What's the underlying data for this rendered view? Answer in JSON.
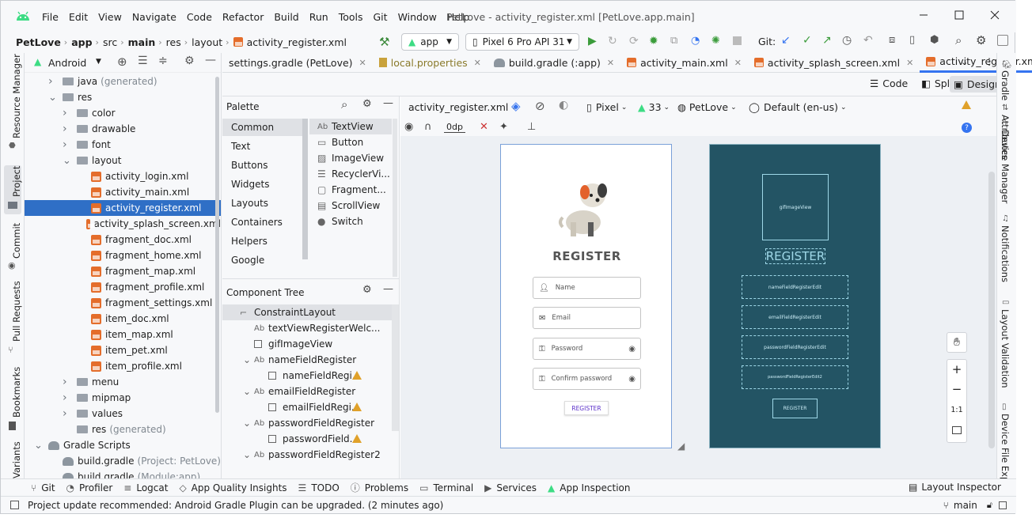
{
  "titlebar": {
    "menu": [
      "File",
      "Edit",
      "View",
      "Navigate",
      "Code",
      "Refactor",
      "Build",
      "Run",
      "Tools",
      "Git",
      "Window",
      "Help"
    ],
    "title": "PetLove - activity_register.xml [PetLove.app.main]"
  },
  "navbar": {
    "breadcrumbs": [
      "PetLove",
      "app",
      "src",
      "main",
      "res",
      "layout",
      "activity_register.xml"
    ],
    "run_config": "app",
    "device": "Pixel 6 Pro API 31",
    "git_label": "Git:"
  },
  "project": {
    "view_label": "Android",
    "tree": [
      {
        "label": "java",
        "suffix": "(generated)",
        "kind": "folder",
        "indent": 1,
        "arrow": ">"
      },
      {
        "label": "res",
        "suffix": "",
        "kind": "folder",
        "indent": 1,
        "arrow": "v"
      },
      {
        "label": "color",
        "suffix": "",
        "kind": "folder",
        "indent": 2,
        "arrow": ">"
      },
      {
        "label": "drawable",
        "suffix": "",
        "kind": "folder",
        "indent": 2,
        "arrow": ">"
      },
      {
        "label": "font",
        "suffix": "",
        "kind": "folder",
        "indent": 2,
        "arrow": ">"
      },
      {
        "label": "layout",
        "suffix": "",
        "kind": "folder",
        "indent": 2,
        "arrow": "v"
      },
      {
        "label": "activity_login.xml",
        "suffix": "",
        "kind": "xml",
        "indent": 3,
        "arrow": ""
      },
      {
        "label": "activity_main.xml",
        "suffix": "",
        "kind": "xml",
        "indent": 3,
        "arrow": ""
      },
      {
        "label": "activity_register.xml",
        "suffix": "",
        "kind": "xml",
        "indent": 3,
        "arrow": "",
        "selected": true
      },
      {
        "label": "activity_splash_screen.xml",
        "suffix": "",
        "kind": "xml",
        "indent": 3,
        "arrow": ""
      },
      {
        "label": "fragment_doc.xml",
        "suffix": "",
        "kind": "xml",
        "indent": 3,
        "arrow": ""
      },
      {
        "label": "fragment_home.xml",
        "suffix": "",
        "kind": "xml",
        "indent": 3,
        "arrow": ""
      },
      {
        "label": "fragment_map.xml",
        "suffix": "",
        "kind": "xml",
        "indent": 3,
        "arrow": ""
      },
      {
        "label": "fragment_profile.xml",
        "suffix": "",
        "kind": "xml",
        "indent": 3,
        "arrow": ""
      },
      {
        "label": "fragment_settings.xml",
        "suffix": "",
        "kind": "xml",
        "indent": 3,
        "arrow": ""
      },
      {
        "label": "item_doc.xml",
        "suffix": "",
        "kind": "xml",
        "indent": 3,
        "arrow": ""
      },
      {
        "label": "item_map.xml",
        "suffix": "",
        "kind": "xml",
        "indent": 3,
        "arrow": ""
      },
      {
        "label": "item_pet.xml",
        "suffix": "",
        "kind": "xml",
        "indent": 3,
        "arrow": ""
      },
      {
        "label": "item_profile.xml",
        "suffix": "",
        "kind": "xml",
        "indent": 3,
        "arrow": ""
      },
      {
        "label": "menu",
        "suffix": "",
        "kind": "folder",
        "indent": 2,
        "arrow": ">"
      },
      {
        "label": "mipmap",
        "suffix": "",
        "kind": "folder",
        "indent": 2,
        "arrow": ">"
      },
      {
        "label": "values",
        "suffix": "",
        "kind": "folder",
        "indent": 2,
        "arrow": ">"
      },
      {
        "label": "res",
        "suffix": "(generated)",
        "kind": "folder",
        "indent": 2,
        "arrow": ""
      },
      {
        "label": "Gradle Scripts",
        "suffix": "",
        "kind": "gradle",
        "indent": 0,
        "arrow": "v"
      },
      {
        "label": "build.gradle",
        "suffix": "(Project: PetLove)",
        "kind": "gradle",
        "indent": 1,
        "arrow": ""
      },
      {
        "label": "build.gradle",
        "suffix": "(Module:app)",
        "kind": "gradle",
        "indent": 1,
        "arrow": ""
      }
    ]
  },
  "left_strip": [
    "Resource Manager",
    "Project",
    "Commit",
    "Pull Requests",
    "Bookmarks",
    "Variants"
  ],
  "right_strip": [
    "Gradle",
    "Attributes",
    "Device Manager",
    "Notifications",
    "Layout Validation",
    "Device File Expl"
  ],
  "tabs": [
    {
      "label": "settings.gradle (PetLove)",
      "active": false
    },
    {
      "label": "local.properties",
      "active": false
    },
    {
      "label": "build.gradle (:app)",
      "active": false
    },
    {
      "label": "activity_main.xml",
      "active": false
    },
    {
      "label": "activity_splash_screen.xml",
      "active": false
    },
    {
      "label": "activity_register.xml",
      "active": true
    }
  ],
  "view_modes": {
    "code": "Code",
    "split": "Split",
    "design": "Design"
  },
  "design_toolbar": {
    "file": "activity_register.xml",
    "device": "Pixel",
    "api": "33",
    "theme": "PetLove",
    "locale": "Default (en-us)",
    "margin": "0dp"
  },
  "palette": {
    "title": "Palette",
    "categories": [
      "Common",
      "Text",
      "Buttons",
      "Widgets",
      "Layouts",
      "Containers",
      "Helpers",
      "Google"
    ],
    "items": [
      {
        "icon": "Ab",
        "label": "TextView"
      },
      {
        "icon": "▭",
        "label": "Button"
      },
      {
        "icon": "▨",
        "label": "ImageView"
      },
      {
        "icon": "☰",
        "label": "RecyclerVi..."
      },
      {
        "icon": "▢",
        "label": "Fragment..."
      },
      {
        "icon": "▤",
        "label": "ScrollView"
      },
      {
        "icon": "●",
        "label": "Switch"
      }
    ]
  },
  "component_tree": {
    "title": "Component Tree",
    "rows": [
      {
        "label": "ConstraintLayout",
        "indent": 0,
        "icon": "layout",
        "warn": false,
        "arrow": ""
      },
      {
        "label": "textViewRegisterWelc...",
        "indent": 1,
        "icon": "Ab",
        "warn": false,
        "arrow": ""
      },
      {
        "label": "gifImageView",
        "indent": 1,
        "icon": "box",
        "warn": false,
        "arrow": ""
      },
      {
        "label": "nameFieldRegister",
        "indent": 1,
        "icon": "Ab",
        "warn": false,
        "arrow": "v"
      },
      {
        "label": "nameFieldRegi...",
        "indent": 2,
        "icon": "box",
        "warn": true,
        "arrow": ""
      },
      {
        "label": "emailFieldRegister",
        "indent": 1,
        "icon": "Ab",
        "warn": false,
        "arrow": "v"
      },
      {
        "label": "emailFieldRegi...",
        "indent": 2,
        "icon": "box",
        "warn": true,
        "arrow": ""
      },
      {
        "label": "passwordFieldRegister",
        "indent": 1,
        "icon": "Ab",
        "warn": false,
        "arrow": "v"
      },
      {
        "label": "passwordField...",
        "indent": 2,
        "icon": "box",
        "warn": true,
        "arrow": ""
      },
      {
        "label": "passwordFieldRegister2",
        "indent": 1,
        "icon": "Ab",
        "warn": false,
        "arrow": "v"
      }
    ]
  },
  "design_preview": {
    "heading": "REGISTER",
    "name_hint": "Name",
    "email_hint": "Email",
    "password_hint": "Password",
    "confirm_hint": "Confirm password",
    "button": "REGISTER"
  },
  "blueprint": {
    "image": "gifImageView",
    "heading": "REGISTER",
    "name": "nameFieldRegisterEdit",
    "email": "emailFieldRegisterEdit",
    "password": "passwordFieldRegisterEdit",
    "password2": "passwordFieldRegisterEdit2",
    "button": "REGISTER"
  },
  "zoom": {
    "ratio": "1:1"
  },
  "tool_windows": [
    "Git",
    "Profiler",
    "Logcat",
    "App Quality Insights",
    "TODO",
    "Problems",
    "Terminal",
    "Services",
    "App Inspection"
  ],
  "layout_inspector": "Layout Inspector",
  "status": {
    "message": "Project update recommended: Android Gradle Plugin can be upgraded. (2 minutes ago)",
    "branch": "main"
  },
  "colors": {
    "accent": "#3574f0",
    "selection": "#2f6fc6",
    "blueprint": "#235464",
    "brand_purple": "#5b2fc9"
  }
}
